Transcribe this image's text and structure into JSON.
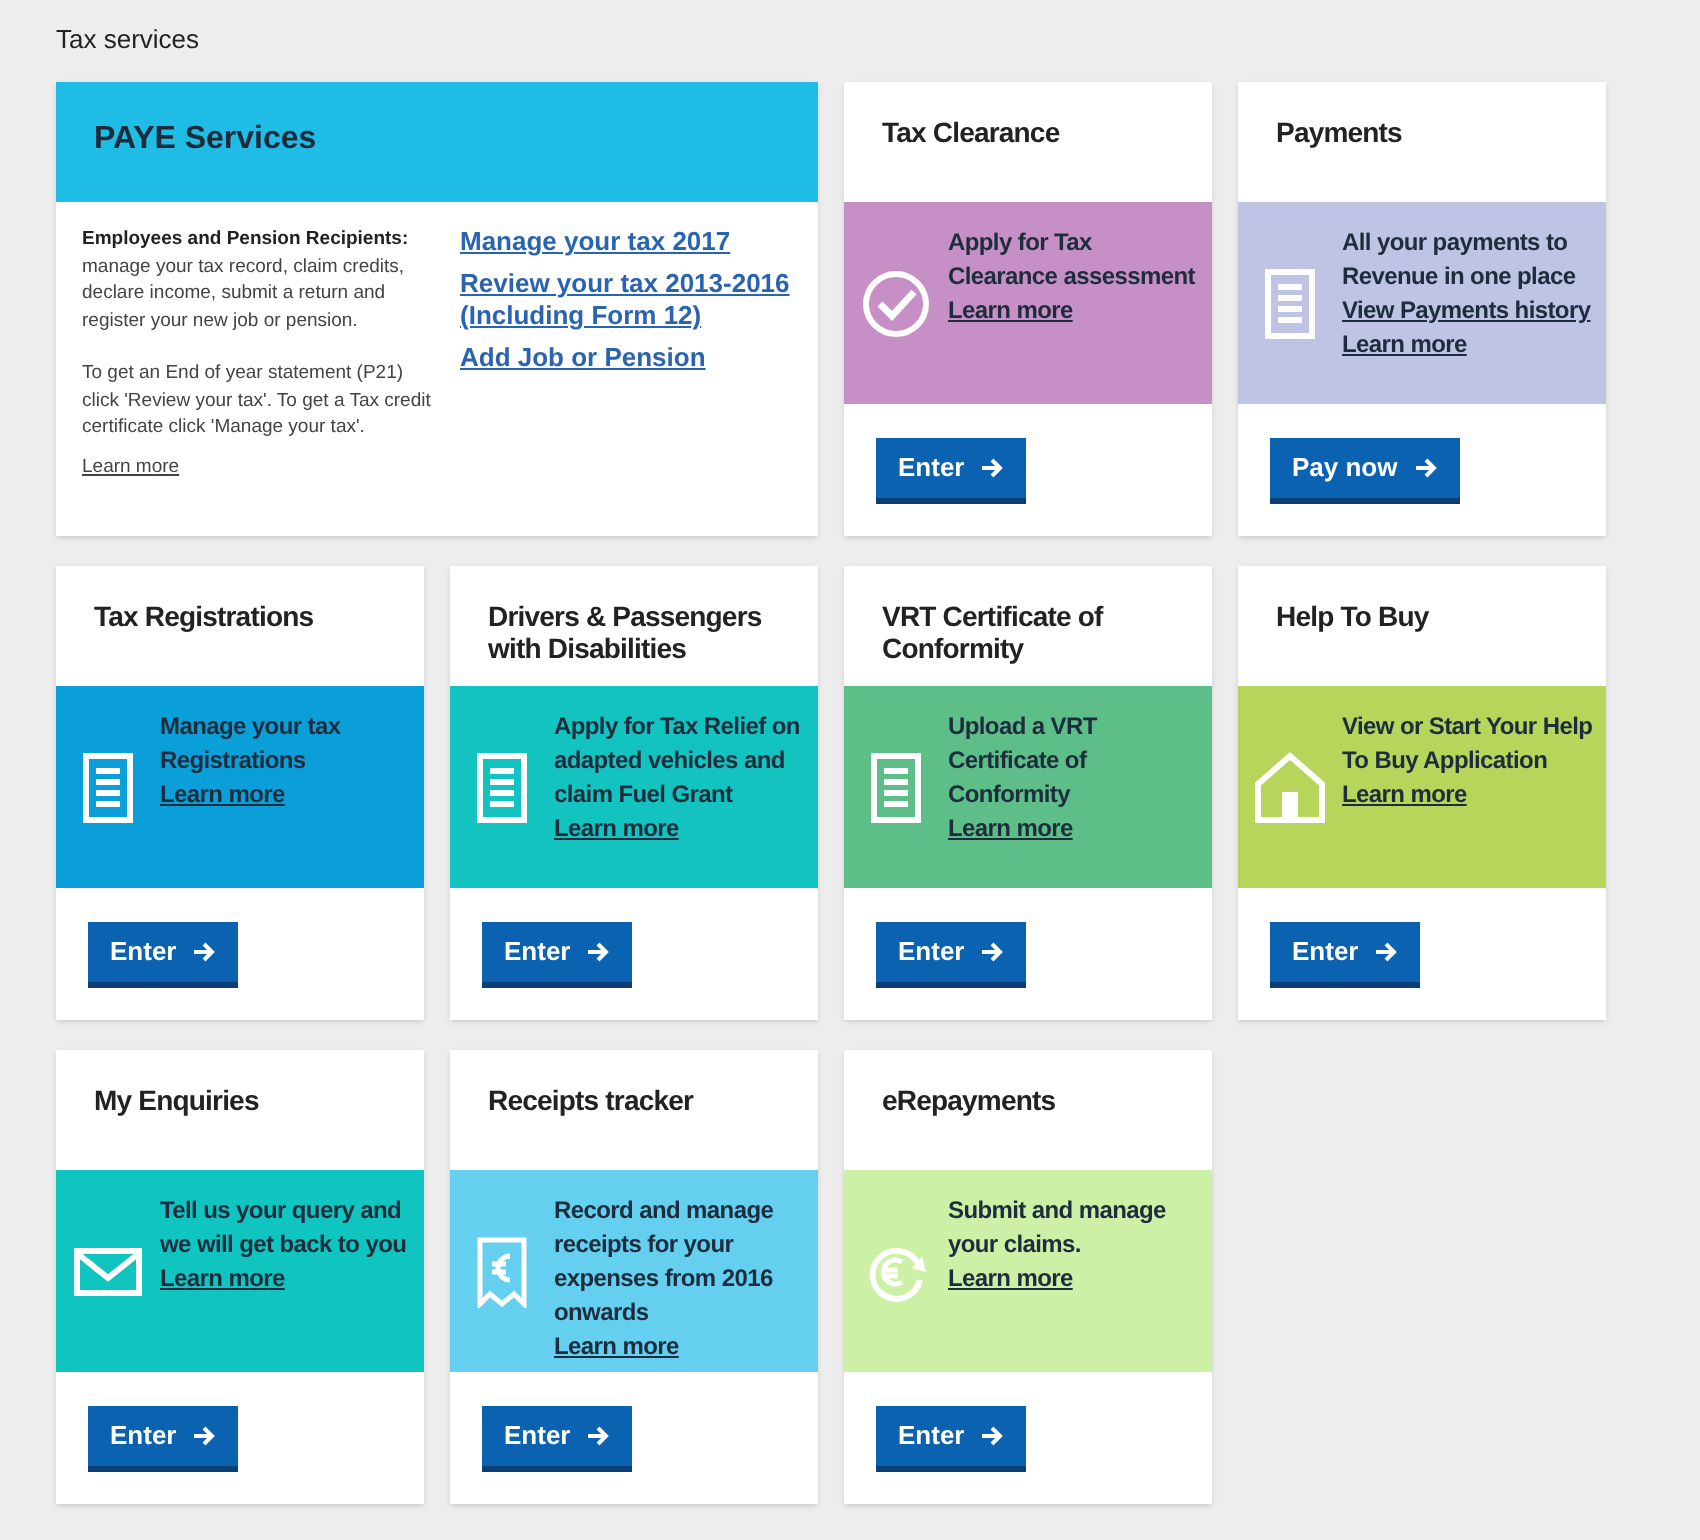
{
  "page_title": "Tax services",
  "paye": {
    "title": "PAYE Services",
    "lead": "Employees and Pension Recipients:",
    "intro": "manage your tax record, claim credits, declare income, submit a return and register your new job or pension.",
    "note": "To get an End of year statement (P21) click 'Review your tax'. To get a Tax credit certificate click 'Manage your tax'.",
    "learn_more": "Learn more",
    "links": [
      "Manage your tax 2017",
      "Review your tax 2013-2016 (Including Form 12)",
      "Add Job or Pension"
    ]
  },
  "tiles": [
    {
      "title": "Tax Clearance",
      "kind": "check",
      "color": "#c68fc6",
      "lines": [
        {
          "kind": "text",
          "text": "Apply for Tax Clearance assessment"
        },
        {
          "kind": "link",
          "text": "Learn more"
        }
      ],
      "button": "Enter"
    },
    {
      "title": "Payments",
      "kind": "document",
      "color": "#bfc3e4",
      "lines": [
        {
          "kind": "text",
          "text": "All your payments to Revenue in one place"
        },
        {
          "kind": "link",
          "text": "View Payments history"
        },
        {
          "kind": "link",
          "text": "Learn more"
        }
      ],
      "button": "Pay now"
    },
    {
      "title": "Tax Registrations",
      "kind": "document",
      "color": "#0a9fd8",
      "lines": [
        {
          "kind": "text",
          "text": "Manage your tax Registrations"
        },
        {
          "kind": "link",
          "text": "Learn more"
        }
      ],
      "button": "Enter"
    },
    {
      "title": "Drivers & Passengers with Disabilities",
      "kind": "document",
      "color": "#12c3bf",
      "lines": [
        {
          "kind": "text",
          "text": "Apply for Tax Relief on adapted vehicles and claim Fuel Grant"
        },
        {
          "kind": "link",
          "text": "Learn more"
        }
      ],
      "button": "Enter"
    },
    {
      "title": "VRT Certificate of Conformity",
      "kind": "document",
      "color": "#5ebe88",
      "lines": [
        {
          "kind": "text",
          "text": "Upload a VRT Certificate of Conformity"
        },
        {
          "kind": "link",
          "text": "Learn more"
        }
      ],
      "button": "Enter"
    },
    {
      "title": "Help To Buy",
      "kind": "house",
      "color": "#b6d55a",
      "lines": [
        {
          "kind": "text",
          "text": "View or Start Your Help To Buy Application"
        },
        {
          "kind": "link",
          "text": "Learn more"
        }
      ],
      "button": "Enter"
    },
    {
      "title": "My Enquiries",
      "kind": "mail",
      "color": "#10c4c0",
      "lines": [
        {
          "kind": "text",
          "text": "Tell us your query and we will get back to you"
        },
        {
          "kind": "link",
          "text": "Learn more"
        }
      ],
      "button": "Enter"
    },
    {
      "title": "Receipts tracker",
      "kind": "receipt",
      "color": "#64cfee",
      "lines": [
        {
          "kind": "text",
          "text": "Record and manage receipts for your expenses from 2016 onwards"
        },
        {
          "kind": "link",
          "text": "Learn more"
        }
      ],
      "button": "Enter"
    },
    {
      "title": "eRepayments",
      "kind": "refund",
      "color": "#ccf0a6",
      "lines": [
        {
          "kind": "text",
          "text": "Submit and manage your claims."
        },
        {
          "kind": "link",
          "text": "Learn more"
        }
      ],
      "button": "Enter"
    }
  ]
}
